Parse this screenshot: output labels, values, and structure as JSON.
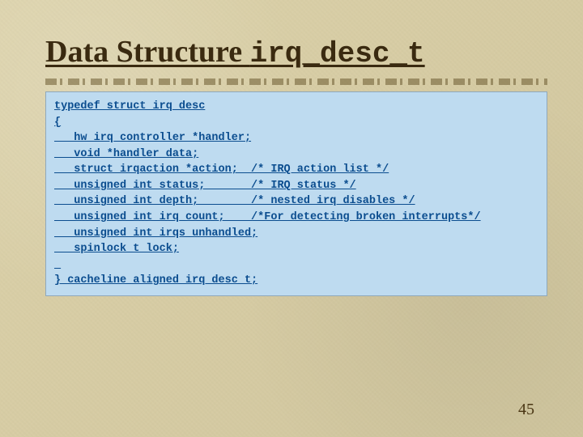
{
  "title": {
    "prefix": "Data Structure ",
    "mono": "irq_desc_t"
  },
  "code": {
    "lines": [
      "typedef struct irq_desc",
      "{",
      "   hw_irq_controller *handler;",
      "   void *handler_data;",
      "   struct irqaction *action;  /* IRQ action list */",
      "   unsigned int status;       /* IRQ status */",
      "   unsigned int depth;        /* nested irq disables */",
      "   unsigned int irq_count;    /*For detecting broken interrupts*/",
      "   unsigned int irqs_unhandled;",
      "   spinlock_t lock;"
    ],
    "closing": "} cacheline_aligned irq_desc_t;"
  },
  "page_number": "45"
}
